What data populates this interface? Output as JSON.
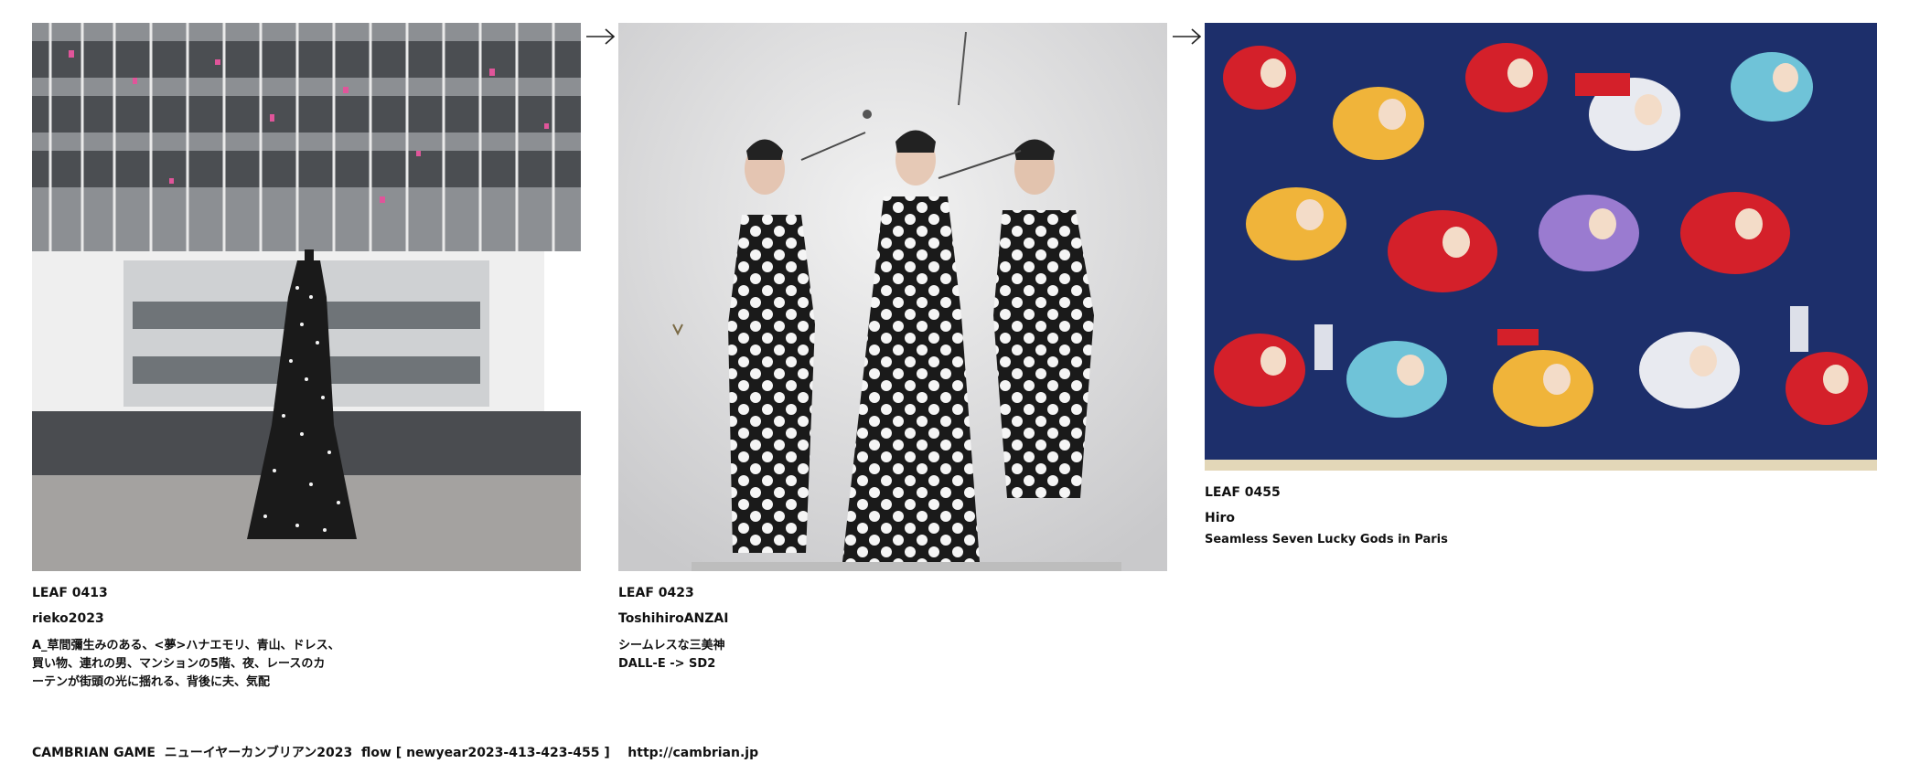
{
  "leaves": [
    {
      "id": "LEAF 0413",
      "author": "rieko2023",
      "description": "A_草間彌生みのある、<夢>ハナエモリ、青山、ドレス、\n買い物、連れの男、マンションの5階、夜、レースのカ\nーテンが街頭の光に揺れる、背後に夫、気配"
    },
    {
      "id": "LEAF 0423",
      "author": "ToshihiroANZAI",
      "description": "シームレスな三美神\nDALL-E -> SD2"
    },
    {
      "id": "LEAF 0455",
      "author": "Hiro",
      "description": "Seamless Seven Lucky Gods in Paris"
    }
  ],
  "footer": "CAMBRIAN GAME  ニューイヤーカンブリアン2023  flow [ newyear2023-413-423-455 ]    http://cambrian.jp",
  "colors": {
    "polka_black": "#1a1a1a",
    "polka_white": "#f5f5f5",
    "pattern_blue": "#1d2f6b",
    "pattern_red": "#d4202a"
  }
}
